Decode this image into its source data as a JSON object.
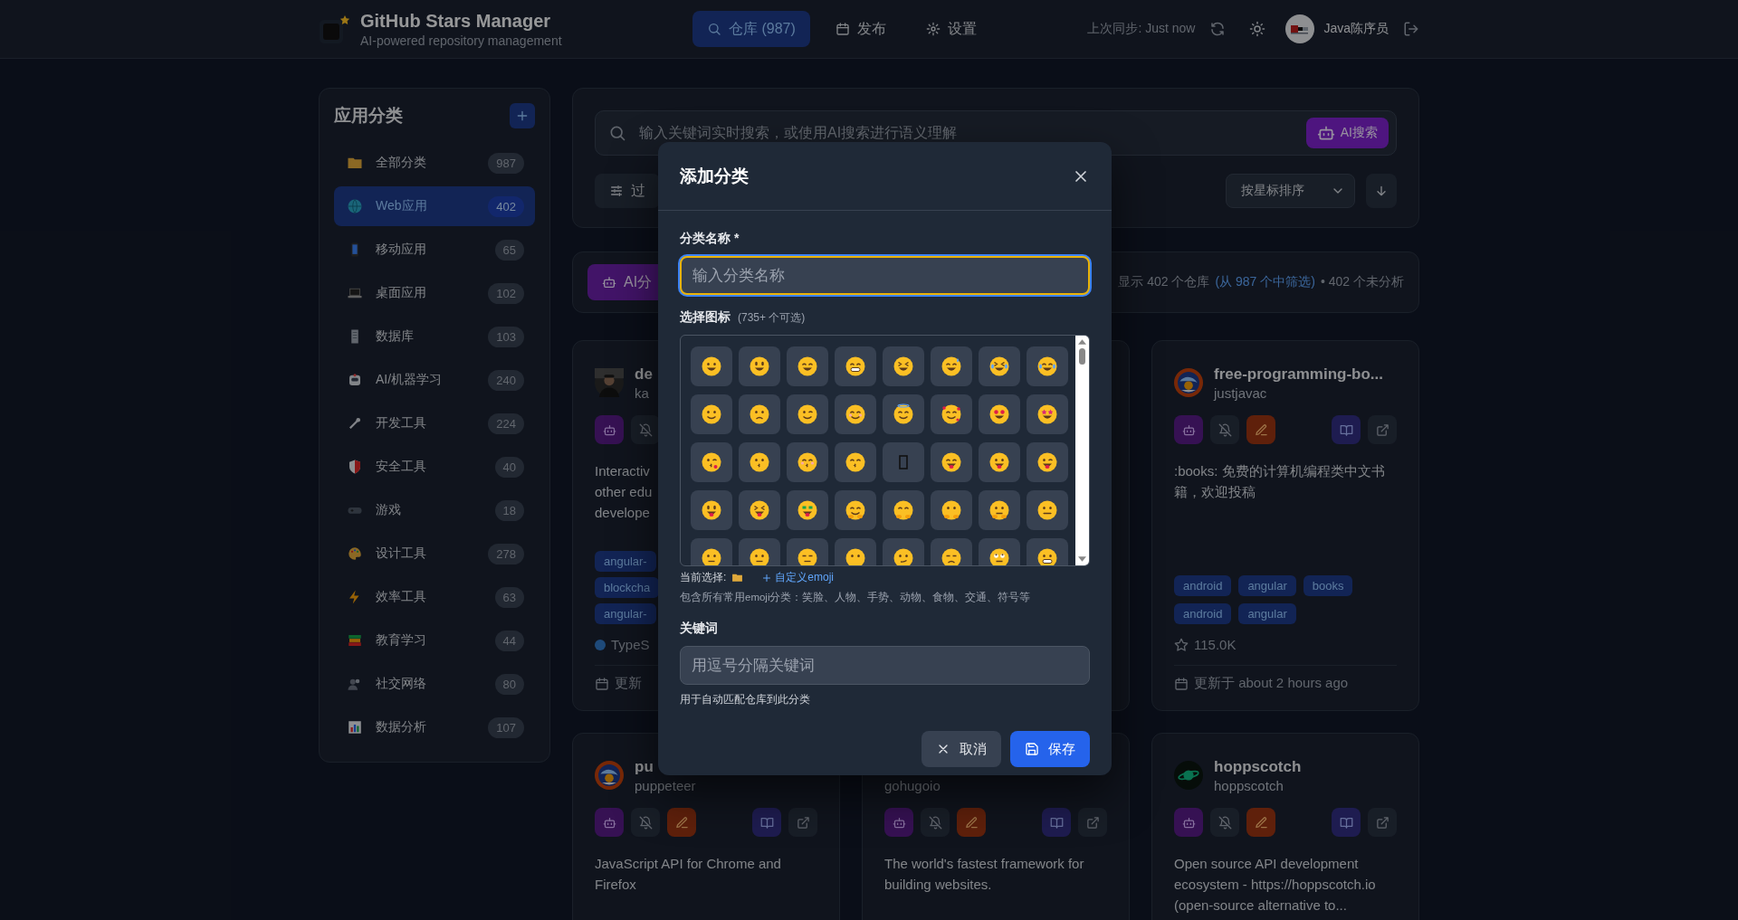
{
  "header": {
    "title": "GitHub Stars Manager",
    "subtitle": "AI-powered repository management",
    "nav": [
      {
        "label": "仓库 (987)",
        "kind": "search",
        "selected": true
      },
      {
        "label": "发布",
        "kind": "calendar",
        "selected": false
      },
      {
        "label": "设置",
        "kind": "gear",
        "selected": false
      }
    ],
    "sync": "上次同步: Just now",
    "user": "Java陈序员"
  },
  "sidebar": {
    "title": "应用分类",
    "items": [
      {
        "kind": "folder",
        "label": "全部分类",
        "count": "987",
        "selected": false
      },
      {
        "kind": "globe",
        "label": "Web应用",
        "count": "402",
        "selected": true
      },
      {
        "kind": "phone",
        "label": "移动应用",
        "count": "65",
        "selected": false
      },
      {
        "kind": "laptop",
        "label": "桌面应用",
        "count": "102",
        "selected": false
      },
      {
        "kind": "server",
        "label": "数据库",
        "count": "103",
        "selected": false
      },
      {
        "kind": "robot",
        "label": "AI/机器学习",
        "count": "240",
        "selected": false
      },
      {
        "kind": "wrench",
        "label": "开发工具",
        "count": "224",
        "selected": false
      },
      {
        "kind": "shield",
        "label": "安全工具",
        "count": "40",
        "selected": false
      },
      {
        "kind": "gamepad",
        "label": "游戏",
        "count": "18",
        "selected": false
      },
      {
        "kind": "palette",
        "label": "设计工具",
        "count": "278",
        "selected": false
      },
      {
        "kind": "bolt",
        "label": "效率工具",
        "count": "63",
        "selected": false
      },
      {
        "kind": "books",
        "label": "教育学习",
        "count": "44",
        "selected": false
      },
      {
        "kind": "people",
        "label": "社交网络",
        "count": "80",
        "selected": false
      },
      {
        "kind": "chart",
        "label": "数据分析",
        "count": "107",
        "selected": false
      }
    ]
  },
  "search": {
    "placeholder": "输入关键词实时搜索，或使用AI搜索进行语义理解",
    "ai_button": "AI搜索",
    "filter_button": "过",
    "sort": "按星标排序"
  },
  "stats": {
    "ai_button": "AI分",
    "shown": "显示 402 个仓库",
    "filtered": "(从 987 个中筛选)",
    "unanalyzed": "• 402 个未分析"
  },
  "cards": [
    {
      "kind": "covered",
      "name": "de",
      "owner": "ka",
      "avatar": {
        "kind": "person"
      },
      "actions": [
        {
          "kind": "ai"
        },
        {
          "kind": "mute"
        }
      ],
      "description_lines": [
        "Interactiv",
        "other edu",
        "develope"
      ],
      "tags": [
        "angular-",
        "blockcha",
        "angular-"
      ],
      "language": "TypeS",
      "updated": "更新"
    },
    {
      "kind": "hidden"
    },
    {
      "kind": "full",
      "name": "free-programming-bo...",
      "owner": "justjavac",
      "avatar": {
        "kind": "picture"
      },
      "actions": [
        {
          "kind": "ai"
        },
        {
          "kind": "mute"
        },
        {
          "kind": "edit"
        },
        {
          "kind": "readme"
        },
        {
          "kind": "open"
        }
      ],
      "description": ":books: 免费的计算机编程类中文书籍，欢迎投稿",
      "tags": [
        "android",
        "angular",
        "books",
        "android",
        "angular"
      ],
      "stars": "115.0K",
      "updated": "更新于 about 2 hours ago"
    },
    {
      "kind": "covered",
      "name": "pu",
      "owner": "puppeteer",
      "avatar": {
        "kind": "picture"
      },
      "actions": [
        {
          "kind": "ai"
        },
        {
          "kind": "mute"
        },
        {
          "kind": "edit"
        },
        {
          "kind": "readme"
        },
        {
          "kind": "open"
        }
      ],
      "description": "JavaScript API for Chrome and Firefox"
    },
    {
      "kind": "full",
      "owner": "gohugoio",
      "actions": [
        {
          "kind": "ai"
        },
        {
          "kind": "mute"
        },
        {
          "kind": "edit"
        },
        {
          "kind": "readme"
        },
        {
          "kind": "open"
        }
      ],
      "description": "The world's fastest framework for building websites."
    },
    {
      "kind": "full",
      "name": "hoppscotch",
      "owner": "hoppscotch",
      "avatar": {
        "kind": "planet"
      },
      "actions": [
        {
          "kind": "ai"
        },
        {
          "kind": "mute"
        },
        {
          "kind": "edit"
        },
        {
          "kind": "readme"
        },
        {
          "kind": "open"
        }
      ],
      "description": "Open source API development ecosystem - https://hoppscotch.io (open-source alternative to..."
    }
  ],
  "modal": {
    "title": "添加分类",
    "name_label": "分类名称 *",
    "name_placeholder": "输入分类名称",
    "icon_label": "选择图标",
    "icon_count": "(735+ 个可选)",
    "emojis": [
      {
        "kind": "grinning"
      },
      {
        "kind": "smiley"
      },
      {
        "kind": "grin"
      },
      {
        "kind": "beaming"
      },
      {
        "kind": "laughing"
      },
      {
        "kind": "sweat"
      },
      {
        "kind": "rofl"
      },
      {
        "kind": "joy"
      },
      {
        "kind": "slight"
      },
      {
        "kind": "upside"
      },
      {
        "kind": "wink"
      },
      {
        "kind": "blush"
      },
      {
        "kind": "halo"
      },
      {
        "kind": "hearts"
      },
      {
        "kind": "hearteyes"
      },
      {
        "kind": "stareyes"
      },
      {
        "kind": "kissheart"
      },
      {
        "kind": "kissing"
      },
      {
        "kind": "kissblush"
      },
      {
        "kind": "kisssmile"
      },
      {
        "kind": "missing"
      },
      {
        "kind": "yum"
      },
      {
        "kind": "tongue"
      },
      {
        "kind": "winktongue"
      },
      {
        "kind": "zany"
      },
      {
        "kind": "squinttongue"
      },
      {
        "kind": "money"
      },
      {
        "kind": "hug"
      },
      {
        "kind": "handmouth"
      },
      {
        "kind": "shush"
      },
      {
        "kind": "thinking"
      },
      {
        "kind": "zipper"
      },
      {
        "kind": "eyebrow"
      },
      {
        "kind": "neutral"
      },
      {
        "kind": "expressionless"
      },
      {
        "kind": "nomouth"
      },
      {
        "kind": "smirk"
      },
      {
        "kind": "unamused"
      },
      {
        "kind": "rolleyes"
      },
      {
        "kind": "grimace"
      }
    ],
    "current_label": "当前选择:",
    "current": {
      "kind": "folder"
    },
    "custom_link": "自定义emoji",
    "icon_help": "包含所有常用emoji分类：笑脸、人物、手势、动物、食物、交通、符号等",
    "keywords_label": "关键词",
    "keywords_placeholder": "用逗号分隔关键词",
    "keywords_help": "用于自动匹配仓库到此分类",
    "cancel": "取消",
    "save": "保存"
  }
}
